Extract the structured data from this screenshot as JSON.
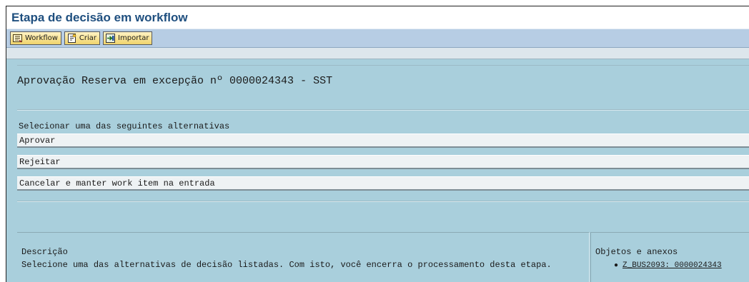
{
  "window": {
    "title": "Etapa de decisão em workflow"
  },
  "toolbar": {
    "buttons": [
      {
        "label": "Workflow",
        "icon": "workflow-icon"
      },
      {
        "label": "Criar",
        "icon": "create-icon"
      },
      {
        "label": "Importar",
        "icon": "import-icon"
      }
    ]
  },
  "main": {
    "heading": "Aprovação Reserva em excepção nº 0000024343 - SST",
    "prompt": "Selecionar uma das seguintes alternativas",
    "alternatives": [
      "Aprovar",
      "Rejeitar",
      "Cancelar e manter work item na entrada"
    ]
  },
  "description": {
    "title": "Descrição",
    "text": "Selecione uma das alternativas de decisão listadas. Com isto, você encerra o processamento desta etapa."
  },
  "objects": {
    "title": "Objetos e anexos",
    "items": [
      "Z_BUS2093: 0000024343"
    ]
  },
  "colors": {
    "background": "#a9cfdc",
    "title": "#1f4f7f",
    "toolbar": "#b7cde4",
    "button": "#f0d46c"
  }
}
